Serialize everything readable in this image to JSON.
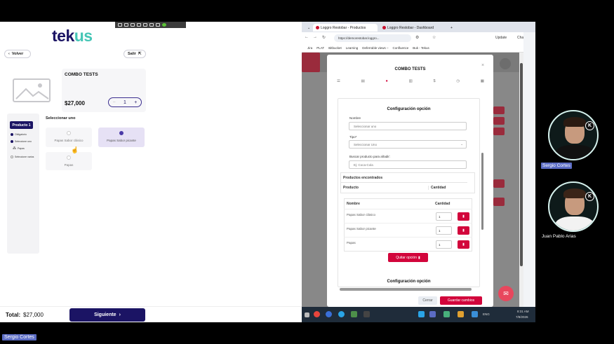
{
  "tekus": {
    "logo_dark": "tek",
    "logo_teal": "us",
    "back_label": "Volver",
    "exit_label": "Salir",
    "combo_title": "COMBO TESTS",
    "price": "$27,000",
    "qty": "1",
    "minus": "−",
    "plus": "+",
    "product_tab": "Producto 1",
    "side_items": [
      "Obligatorio",
      "Seleccione uno",
      "Papas",
      "Seleccione varios"
    ],
    "select_one": "Seleccionar uno",
    "options": [
      "Papas Sabor clásico",
      "Papas Sabor picante",
      "Papas"
    ],
    "total_label": "Total:",
    "total_value": "$27,000",
    "next_label": "Siguiente",
    "next_arrow": "›"
  },
  "browser": {
    "tabs": [
      "Loggro Restobar - Productos",
      "Loggro Restobar - Dashboard"
    ],
    "url": "https://demorestobar.loggro...",
    "bookmarks": [
      "Jira",
      "PLAT",
      "Bitbucket",
      "Learning",
      "Deferrable views –",
      "Confluence",
      "Buk - Tekus"
    ],
    "update_label": "Update",
    "chat_label": "Chat"
  },
  "modal": {
    "title": "COMBO TESTS",
    "close": "×",
    "section_title": "Configuración opción",
    "name_label": "Nombre",
    "name_placeholder": "Seleccionar uno",
    "type_label": "Tipo*",
    "type_value": "Seleccionar Uno",
    "search_label": "Buscar producto para añadir:",
    "search_placeholder": "Ej: Coca-Cola",
    "found_title": "Productos encontrados",
    "col_product": "Producto",
    "col_qty": "Cantidad",
    "col_name": "Nombre",
    "rows": [
      {
        "name": "Papas Sabor clásico",
        "qty": "1"
      },
      {
        "name": "Papas Sabor picante",
        "qty": "1"
      },
      {
        "name": "Papas",
        "qty": "1"
      }
    ],
    "remove_option": "Quitar opción",
    "section_title_2": "Configuración opción",
    "cancel": "Cerrar",
    "save": "Guardar cambios"
  },
  "taskbar": {
    "lang": "ENG",
    "time": "8:31 AM",
    "date": "7/8/2026"
  },
  "participants": [
    {
      "name": "Sergio Cortes"
    },
    {
      "name": "Juan Pablo Arias"
    }
  ],
  "presenter": "Sergio Cortes",
  "colors": {
    "brand_dark": "#1b1464",
    "brand_teal": "#46c6b6",
    "accent_red": "#d2053b"
  }
}
